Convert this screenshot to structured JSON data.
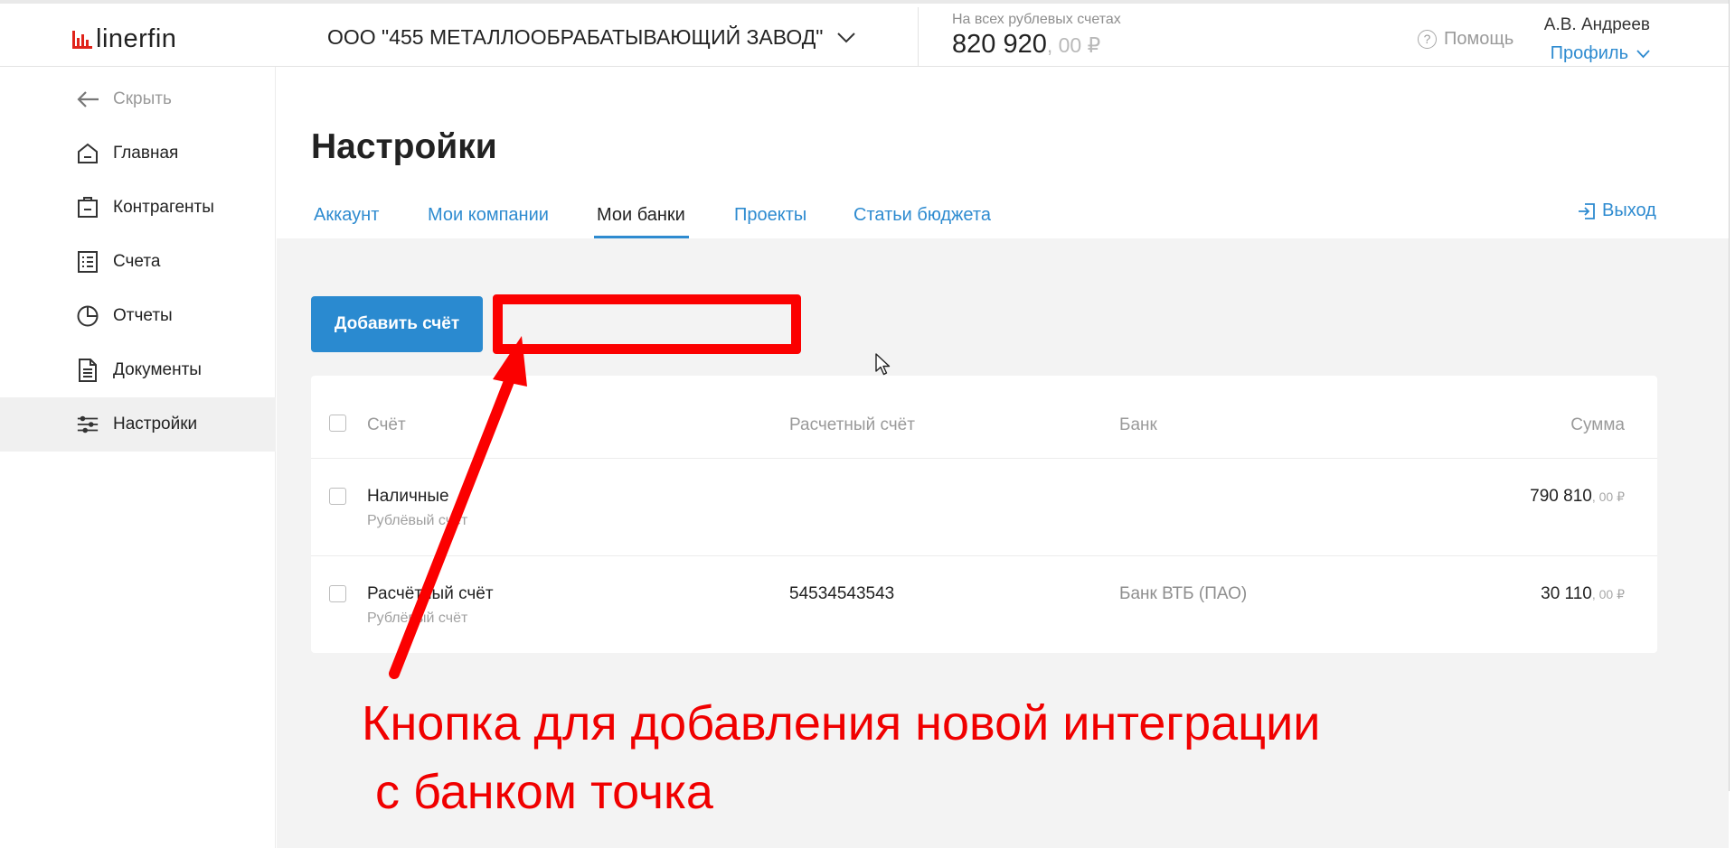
{
  "app": {
    "logo_part1": "linerfin",
    "logo_part2": ""
  },
  "header": {
    "company": "ООО \"455 МЕТАЛЛООБРАБАТЫВАЮЩИЙ ЗАВОД\"",
    "balance_caption": "На всех рублевых счетах",
    "balance_amount": "820 920",
    "balance_decimals": ", 00 ₽",
    "help": "Помощь",
    "help_icon": "?",
    "user_name": "А.В. Андреев",
    "profile": "Профиль"
  },
  "sidebar": {
    "hide": "Скрыть",
    "items": [
      {
        "label": "Главная",
        "icon": "home-icon"
      },
      {
        "label": "Контрагенты",
        "icon": "contacts-icon"
      },
      {
        "label": "Счета",
        "icon": "accounts-icon"
      },
      {
        "label": "Отчеты",
        "icon": "reports-icon"
      },
      {
        "label": "Документы",
        "icon": "documents-icon"
      },
      {
        "label": "Настройки",
        "icon": "settings-icon",
        "active": true
      }
    ]
  },
  "page": {
    "title": "Настройки",
    "tabs": [
      {
        "label": "Аккаунт"
      },
      {
        "label": "Мои компании"
      },
      {
        "label": "Мои банки",
        "active": true
      },
      {
        "label": "Проекты"
      },
      {
        "label": "Статьи бюджета"
      }
    ],
    "exit": "Выход",
    "add_button": "Добавить счёт"
  },
  "table": {
    "headers": {
      "account": "Счёт",
      "settlement": "Расчетный счёт",
      "bank": "Банк",
      "sum": "Сумма"
    },
    "rows": [
      {
        "name": "Наличные",
        "type": "Рублёвый счёт",
        "settlement": "",
        "bank": "",
        "sum": "790 810",
        "sum_dec": ", 00 ₽"
      },
      {
        "name": "Расчётный счёт",
        "type": "Рублёвый счёт",
        "settlement": "54534543543",
        "bank": "Банк ВТБ (ПАО)",
        "sum": "30 110",
        "sum_dec": ", 00 ₽"
      }
    ]
  },
  "annotation": {
    "text_line1": "Кнопка для добавления новой интеграции",
    "text_line2": " с банком точка",
    "color": "#f00000"
  },
  "colors": {
    "accent": "#2e8bd0",
    "button": "#2a8ad0",
    "brand_red": "#e0231a"
  }
}
